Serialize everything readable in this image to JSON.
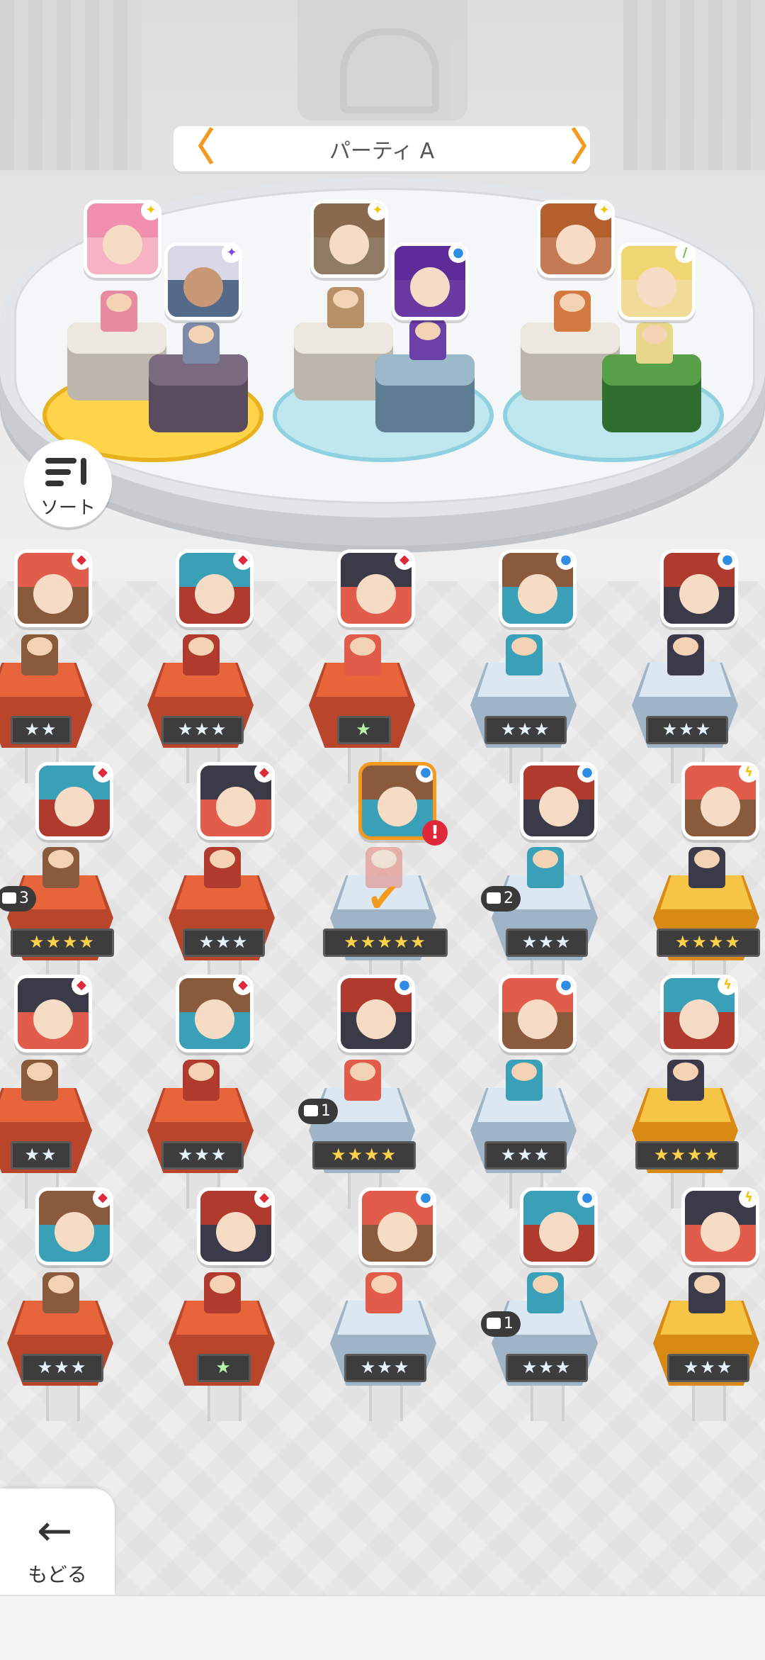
{
  "party": {
    "title": "パーティ A",
    "prev_arrow": "〈",
    "next_arrow": "〉"
  },
  "sort": {
    "label": "ソート",
    "icon": "sort-icon"
  },
  "back": {
    "label": "もどる",
    "icon": "arrow-left-icon",
    "glyph": "←"
  },
  "colors": {
    "accent": "#f39a1f",
    "element_fire": "#e0283b",
    "element_water": "#2f8de4",
    "element_wind": "#5ec43a",
    "element_light": "#f2c200",
    "element_dark": "#7d4ad8"
  },
  "team": [
    {
      "slot": 1,
      "front_element": "light",
      "back_element": "dark"
    },
    {
      "slot": 2,
      "front_element": "light",
      "back_element": "water"
    },
    {
      "slot": 3,
      "front_element": "light",
      "back_element": "wind"
    }
  ],
  "roster": [
    {
      "row": 1,
      "units": [
        {
          "element": "fire",
          "stars": "★★"
        },
        {
          "element": "fire",
          "stars": "★★★"
        },
        {
          "element": "fire",
          "stars": "★"
        },
        {
          "element": "water",
          "stars": "★★★"
        },
        {
          "element": "water",
          "stars": "★★★"
        }
      ]
    },
    {
      "row": 2,
      "units": [
        {
          "element": "fire",
          "stars": "★★★★",
          "dup": "3"
        },
        {
          "element": "fire",
          "stars": "★★★"
        },
        {
          "element": "water",
          "stars": "★★★★★",
          "selected": true,
          "warning": "!"
        },
        {
          "element": "water",
          "stars": "★★★",
          "dup": "2"
        },
        {
          "element": "thunder",
          "stars": "★★★★"
        }
      ]
    },
    {
      "row": 3,
      "units": [
        {
          "element": "fire",
          "stars": "★★"
        },
        {
          "element": "fire",
          "stars": "★★★"
        },
        {
          "element": "water",
          "stars": "★★★★",
          "dup": "1"
        },
        {
          "element": "water",
          "stars": "★★★"
        },
        {
          "element": "thunder",
          "stars": "★★★★"
        }
      ]
    },
    {
      "row": 4,
      "units": [
        {
          "element": "fire",
          "stars": "★★★"
        },
        {
          "element": "fire",
          "stars": "★"
        },
        {
          "element": "water",
          "stars": "★★★"
        },
        {
          "element": "water",
          "stars": "★★★",
          "dup": "1"
        },
        {
          "element": "thunder",
          "stars": "★★★"
        }
      ]
    }
  ]
}
